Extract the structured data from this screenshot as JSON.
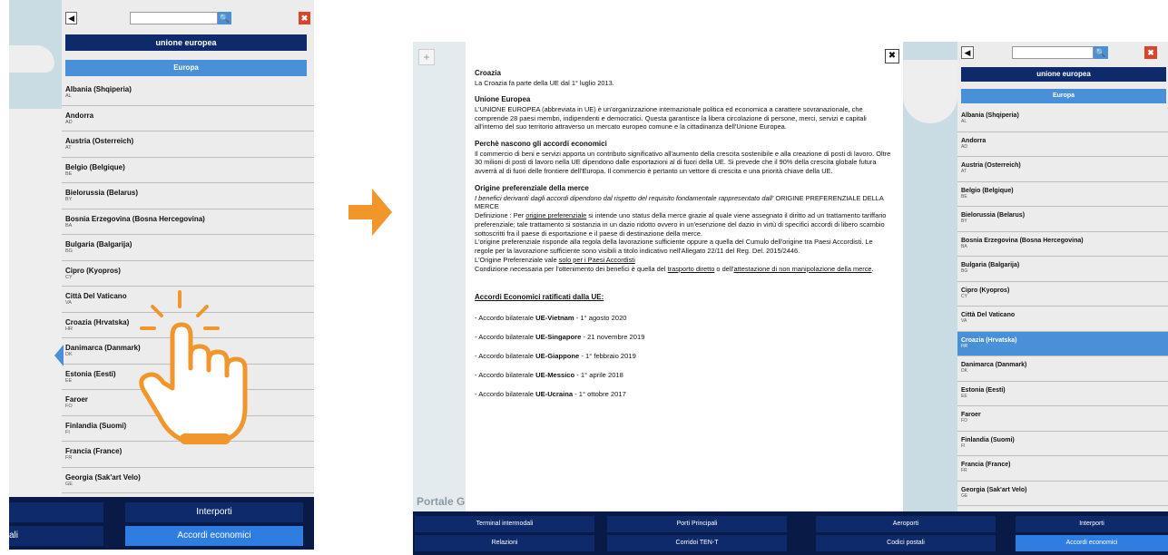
{
  "left_panel": {
    "header_title": "unione europea",
    "sub_header": "Europa",
    "countries": [
      {
        "name": "Albania  (Shqiperia)",
        "code": "AL"
      },
      {
        "name": "Andorra",
        "code": "AD"
      },
      {
        "name": "Austria  (Osterreich)",
        "code": "AT"
      },
      {
        "name": "Belgio (Belgique)",
        "code": "BE"
      },
      {
        "name": "Bielorussia (Belarus)",
        "code": "BY"
      },
      {
        "name": "Bosnia Erzegovina (Bosna Hercegovina)",
        "code": "BA"
      },
      {
        "name": "Bulgaria (Balgarija)",
        "code": "BG"
      },
      {
        "name": "Cipro (Kyopros)",
        "code": "CY"
      },
      {
        "name": "Città Del Vaticano",
        "code": "VA"
      },
      {
        "name": "Croazia  (Hrvatska)",
        "code": "HR"
      },
      {
        "name": "Danimarca (Danmark)",
        "code": "DK"
      },
      {
        "name": "Estonia (Eesti)",
        "code": "EE"
      },
      {
        "name": "Faroer",
        "code": "FO"
      },
      {
        "name": "Finlandia (Suomi)",
        "code": "FI"
      },
      {
        "name": "Francia (France)",
        "code": "FR"
      },
      {
        "name": "Georgia  (Sak'art Velo)",
        "code": "GE"
      }
    ],
    "nav": {
      "left_bottom_partial": "ali",
      "interporti": "Interporti",
      "accordi": "Accordi economici"
    }
  },
  "right_panel": {
    "header_title": "unione europea",
    "sub_header": "Europa",
    "portale_label": "Portale G",
    "plus_label": "+",
    "countries": [
      {
        "name": "Albania  (Shqiperia)",
        "code": "AL"
      },
      {
        "name": "Andorra",
        "code": "AD"
      },
      {
        "name": "Austria  (Osterreich)",
        "code": "AT"
      },
      {
        "name": "Belgio (Belgique)",
        "code": "BE"
      },
      {
        "name": "Bielorussia (Belarus)",
        "code": "BY"
      },
      {
        "name": "Bosnia Erzegovina (Bosna Hercegovina)",
        "code": "BA"
      },
      {
        "name": "Bulgaria (Balgarija)",
        "code": "BG"
      },
      {
        "name": "Cipro (Kyopros)",
        "code": "CY"
      },
      {
        "name": "Città Del Vaticano",
        "code": "VA"
      },
      {
        "name": "Croazia  (Hrvatska)",
        "code": "HR"
      },
      {
        "name": "Danimarca (Danmark)",
        "code": "DK"
      },
      {
        "name": "Estonia (Eesti)",
        "code": "EE"
      },
      {
        "name": "Faroer",
        "code": "FO"
      },
      {
        "name": "Finlandia (Suomi)",
        "code": "FI"
      },
      {
        "name": "Francia (France)",
        "code": "FR"
      },
      {
        "name": "Georgia  (Sak'art Velo)",
        "code": "GE"
      }
    ],
    "nav_top": [
      "Terminal intermodali",
      "Porti Principali",
      "Aeroporti",
      "Interporti"
    ],
    "nav_bottom": [
      "Relazioni",
      "Corridoi TEN-T",
      "Codici postali",
      "Accordi economici"
    ]
  },
  "doc": {
    "s1_title": "Croazia",
    "s1_body": "La Croazia fa parte della UE dal 1° luglio 2013.",
    "s2_title": "Unione Europea",
    "s2_body": "L'UNIONE EUROPEA (abbreviata in UE) è un'organizzazione internazionale politica ed economica a carattere sovranazionale, che comprende 28 paesi membri, indipendenti e democratici. Questa garantisce la libera circolazione di persone, merci, servizi e capitali all'interno del suo territorio attraverso un mercato europeo comune e la cittadinanza dell'Unione Europea.",
    "s3_title": "Perchè nascono gli accordi economici",
    "s3_body": "Il commercio di beni e servizi apporta un contributo significativo all'aumento della crescita sostenibile e alla creazione di posti di lavoro. Oltre 30 milioni di posti di lavoro nella UE dipendono dalle esportazioni al di fuori della UE. Si prevede che il 90% della crescita globale futura avverrà  al di fuori delle frontiere dell'Europa. Il commercio è pertanto un vettore di crescita e una priorità chiave della UE.",
    "s4_title": "Origine preferenziale della merce",
    "s4_italic": "I benefici derivanti dagli accordi dipendono dal rispetto del requisito fondamentale rappresentato dall'",
    "s4_italic_end": " ORIGINE PREFERENZIALE DELLA MERCE",
    "s4_def_prefix": "Definizione : Per ",
    "s4_def_link": "origine preferenziale",
    "s4_def_rest": " si intende uno status della merce grazie al quale viene assegnato il diritto ad un trattamento tariffario preferenziale; tale trattamento si sostanzia in un dazio ridotto ovvero in un'esenzione del dazio in virtù di specifici accordi di libero scambio sottoscritti fra il paese di esportazione e il paese di destinazione della merce.",
    "s4_rules": "L'origine preferenziale risponde alla regola della lavorazione sufficiente oppure a quella del Cumulo dell'origine tra Paesi Accordisti. Le regole per la lavorazione sufficiente sono visibili a titolo indicativo nell'Allegato 22/11 del Reg. Del. 2015/2446.",
    "s4_vale_prefix": "L'Origine Preferenziale vale ",
    "s4_vale_link": "solo per i Paesi Accordisti",
    "s4_cond_prefix": "Condizione necessaria per l'ottenimento dei benefici è quella del ",
    "s4_cond_link1": "trasporto diretto",
    "s4_cond_mid": " o dell'",
    "s4_cond_link2": "attestazione di non manipolazione della merce",
    "s4_cond_end": ".",
    "s5_title": "Accordi Economici ratificati dalla UE:",
    "agreements": [
      {
        "prefix": "- Accordo bilaterale ",
        "bold": "UE-Vietnam",
        "date": " - 1° agosto 2020"
      },
      {
        "prefix": "- Accordo bilaterale ",
        "bold": "UE-Singapore",
        "date": " - 21 novembre 2019"
      },
      {
        "prefix": "- Accordo bilaterale ",
        "bold": "UE-Giappone",
        "date": " - 1° febbraio 2019"
      },
      {
        "prefix": "- Accordo bilaterale ",
        "bold": "UE-Messico",
        "date": " - 1° aprile 2018"
      },
      {
        "prefix": "- Accordo bilaterale ",
        "bold": "UE-Ucraina",
        "date": " - 1° ottobre 2017"
      }
    ]
  },
  "icons": {
    "back": "◀",
    "search": "🔍",
    "close_red": "✖",
    "doc_close": "✖"
  },
  "colors": {
    "navy": "#0e2a6b",
    "accent_blue": "#4a90d9",
    "orange": "#f0962a",
    "close_red": "#d9442b"
  }
}
